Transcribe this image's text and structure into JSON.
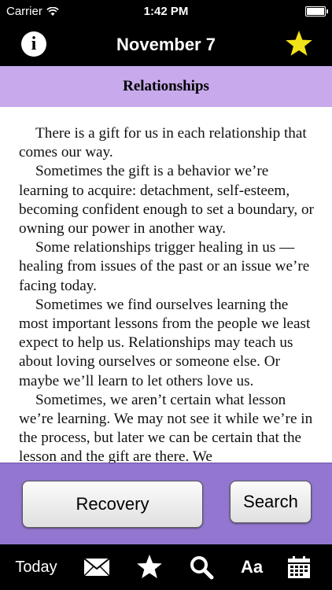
{
  "status_bar": {
    "carrier": "Carrier",
    "time": "1:42 PM"
  },
  "nav": {
    "title": "November 7",
    "info_glyph": "i",
    "favorite_icon": "star-icon",
    "favorite_color": "#f2e21a"
  },
  "section": {
    "title": "Relationships"
  },
  "reading": {
    "paragraphs": [
      "There is a gift for us in each relationship that comes our way.",
      "Sometimes the gift is a behavior we’re learning to acquire: detachment, self-esteem, becoming confident enough to set a boundary, or owning our power in another way.",
      "Some relationships trigger healing in us —healing from issues of the past or an issue we’re facing today.",
      "Sometimes we find ourselves learning the most important lessons from the people we least expect to help us. Relationships may teach us about loving ourselves or someone else. Or maybe we’ll learn to let others love us.",
      "Sometimes, we aren’t certain what lesson we’re learning. We may not see it while we’re in the process, but later we can be certain that the lesson and the gift are there. We"
    ]
  },
  "buttons": {
    "recovery": "Recovery",
    "search": "Search"
  },
  "tab_bar": {
    "today": "Today",
    "font": "Aa"
  },
  "colors": {
    "header_purple": "#c7a9ec",
    "overlay_purple": "#8160c8"
  }
}
